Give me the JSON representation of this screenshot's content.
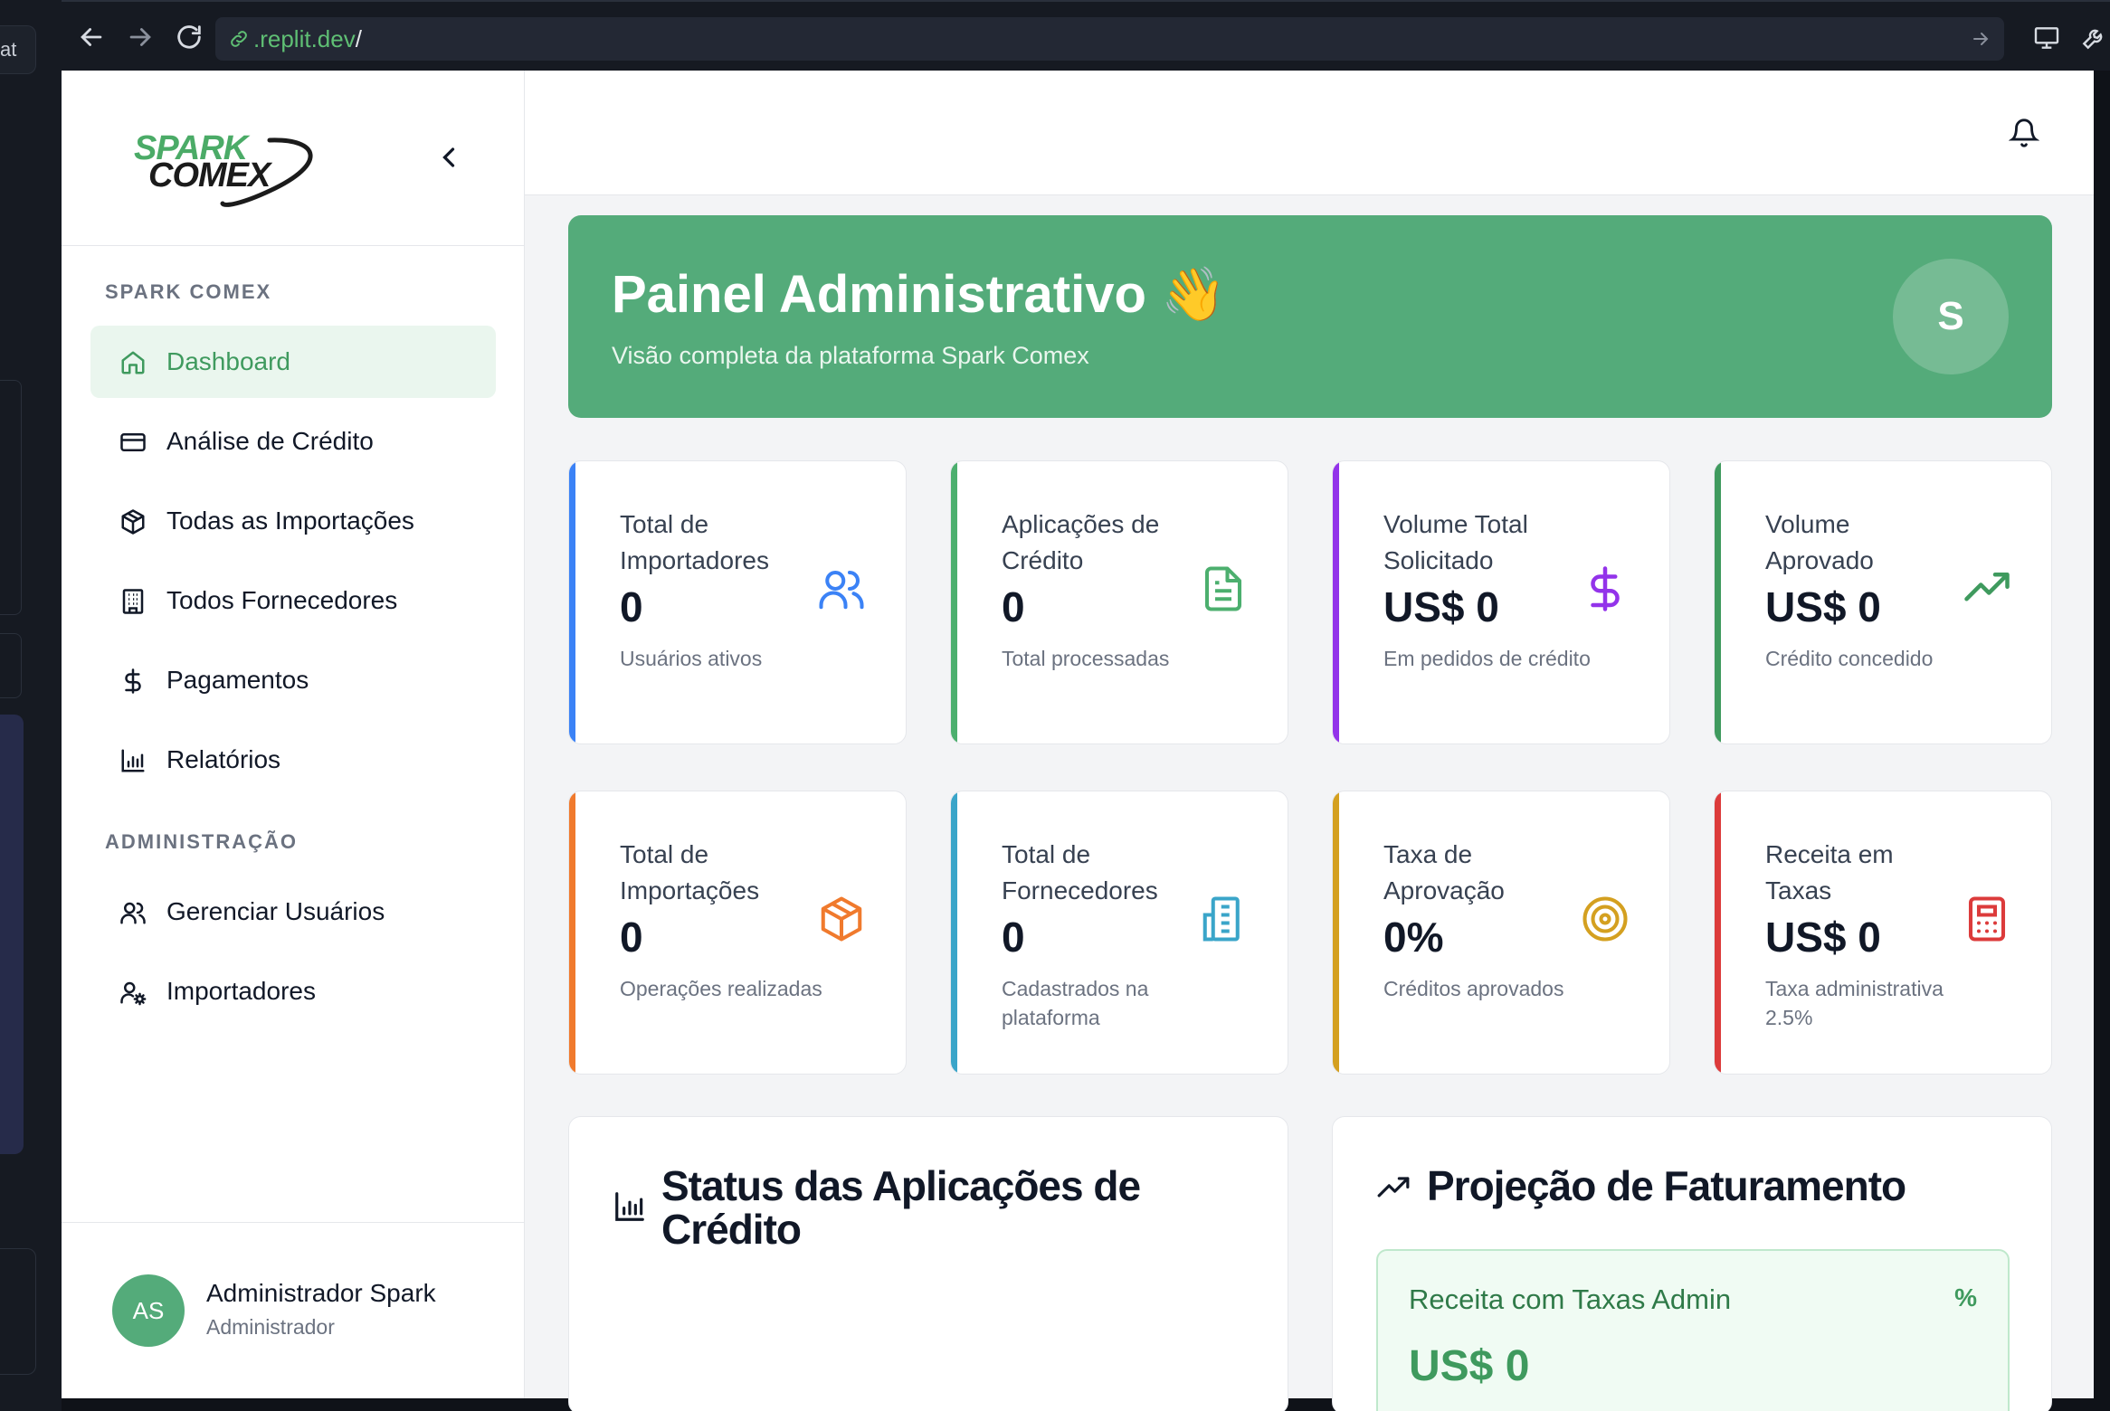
{
  "browser": {
    "url_host": ".replit.dev",
    "url_path": "/",
    "left_tab_fragment": "at"
  },
  "sidebar": {
    "logo_line1": "SPARK",
    "logo_line2": "COMEX",
    "sections": [
      {
        "label": "SPARK COMEX",
        "items": [
          {
            "label": "Dashboard",
            "icon": "home-icon",
            "active": true
          },
          {
            "label": "Análise de Crédito",
            "icon": "credit-card-icon"
          },
          {
            "label": "Todas as Importações",
            "icon": "package-icon"
          },
          {
            "label": "Todos Fornecedores",
            "icon": "building-icon"
          },
          {
            "label": "Pagamentos",
            "icon": "dollar-icon"
          },
          {
            "label": "Relatórios",
            "icon": "bar-chart-icon"
          }
        ]
      },
      {
        "label": "ADMINISTRAÇÃO",
        "items": [
          {
            "label": "Gerenciar Usuários",
            "icon": "users-icon"
          },
          {
            "label": "Importadores",
            "icon": "user-cog-icon"
          }
        ]
      }
    ],
    "user": {
      "initials": "AS",
      "name": "Administrador Spark",
      "role": "Administrador"
    }
  },
  "hero": {
    "title": "Painel Administrativo",
    "emoji": "👋",
    "subtitle": "Visão completa da plataforma Spark Comex",
    "avatar_initial": "S"
  },
  "stats": [
    {
      "title": "Total de Importadores",
      "value": "0",
      "sub": "Usuários ativos",
      "icon": "users-icon",
      "color": "#3b82f6"
    },
    {
      "title": "Aplicações de Crédito",
      "value": "0",
      "sub": "Total processadas",
      "icon": "file-text-icon",
      "color": "#4caf6e"
    },
    {
      "title": "Volume Total Solicitado",
      "value": "US$ 0",
      "sub": "Em pedidos de crédito",
      "icon": "dollar-icon",
      "color": "#9333ea"
    },
    {
      "title": "Volume Aprovado",
      "value": "US$ 0",
      "sub": "Crédito concedido",
      "icon": "trending-up-icon",
      "color": "#3f9a5e"
    },
    {
      "title": "Total de Importações",
      "value": "0",
      "sub": "Operações realizadas",
      "icon": "package-icon",
      "color": "#f07a2d"
    },
    {
      "title": "Total de Fornecedores",
      "value": "0",
      "sub": "Cadastrados na plataforma",
      "icon": "building-icon",
      "color": "#3aa5c9"
    },
    {
      "title": "Taxa de Aprovação",
      "value": "0%",
      "sub": "Créditos aprovados",
      "icon": "target-icon",
      "color": "#d4a020"
    },
    {
      "title": "Receita em Taxas",
      "value": "US$ 0",
      "sub": "Taxa administrativa 2.5%",
      "icon": "calculator-icon",
      "color": "#dc3b3b"
    }
  ],
  "panels": {
    "status_title": "Status das Aplicações de Crédito",
    "projection_title": "Projeção de Faturamento",
    "revenue_label": "Receita com Taxas Admin",
    "revenue_pct_symbol": "%",
    "revenue_value": "US$ 0"
  },
  "colors": {
    "brand_green": "#54ab7a",
    "active_text": "#3f9a5e"
  }
}
